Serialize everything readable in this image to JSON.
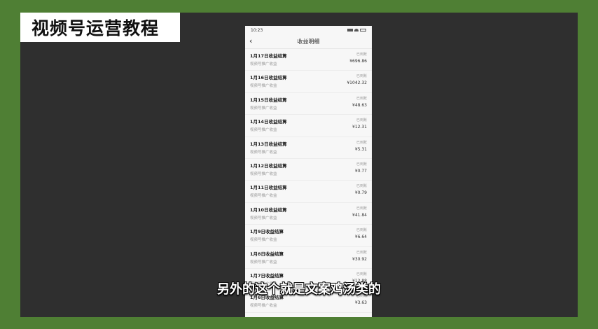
{
  "course_tag": "视频号运营教程",
  "phone": {
    "status_time": "10:23",
    "nav_title": "收益明细",
    "rows": [
      {
        "title": "1月17日收益结算",
        "sub": "视频号推广收益",
        "status": "已到账",
        "amount": "¥696.86"
      },
      {
        "title": "1月16日收益结算",
        "sub": "视频号推广收益",
        "status": "已到账",
        "amount": "¥1042.32"
      },
      {
        "title": "1月15日收益结算",
        "sub": "视频号推广收益",
        "status": "已到账",
        "amount": "¥48.63"
      },
      {
        "title": "1月14日收益结算",
        "sub": "视频号推广收益",
        "status": "已到账",
        "amount": "¥12.31"
      },
      {
        "title": "1月13日收益结算",
        "sub": "视频号推广收益",
        "status": "已到账",
        "amount": "¥5.31"
      },
      {
        "title": "1月12日收益结算",
        "sub": "视频号推广收益",
        "status": "已到账",
        "amount": "¥0.77"
      },
      {
        "title": "1月11日收益结算",
        "sub": "视频号推广收益",
        "status": "已到账",
        "amount": "¥0.79"
      },
      {
        "title": "1月10日收益结算",
        "sub": "视频号推广收益",
        "status": "已到账",
        "amount": "¥41.84"
      },
      {
        "title": "1月9日收益结算",
        "sub": "视频号推广收益",
        "status": "已到账",
        "amount": "¥6.64"
      },
      {
        "title": "1月8日收益结算",
        "sub": "视频号推广收益",
        "status": "已到账",
        "amount": "¥30.92"
      },
      {
        "title": "1月7日收益结算",
        "sub": "视频号推广收益",
        "status": "已到账",
        "amount": "¥12.88"
      },
      {
        "title": "1月6日收益结算",
        "sub": "视频号推广收益",
        "status": "已到账",
        "amount": "¥3.63"
      }
    ]
  },
  "subtitle": "另外的这个就是文案鸡汤类的"
}
